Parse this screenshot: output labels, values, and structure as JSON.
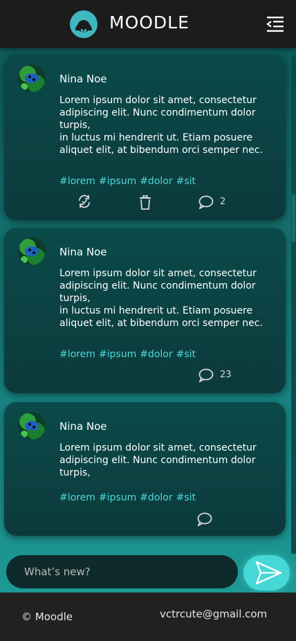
{
  "header": {
    "brand": "MOODLE",
    "logo_icon": "moodle-logo-icon",
    "menu_icon": "menu-collapse-icon"
  },
  "posts": [
    {
      "author": "Nina Noe",
      "text": "Lorem ipsum dolor sit amet, consectetur adipiscing elit. Nunc condimentum dolor turpis,\nin luctus mi hendrerit ut. Etiam posuere aliquet elit, at bibendum orci semper nec.",
      "tags": [
        "#lorem",
        "#ipsum",
        "#dolor",
        "#sit"
      ],
      "show_repost": true,
      "show_delete": true,
      "comments": "2"
    },
    {
      "author": "Nina Noe",
      "text": "Lorem ipsum dolor sit amet, consectetur adipiscing elit. Nunc condimentum dolor turpis,\nin luctus mi hendrerit ut. Etiam posuere aliquet elit, at bibendum orci semper nec.",
      "tags": [
        "#lorem",
        "#ipsum",
        "#dolor",
        "#sit"
      ],
      "show_repost": false,
      "show_delete": false,
      "comments": "23"
    },
    {
      "author": "Nina Noe",
      "text": "Lorem ipsum dolor sit amet, consectetur adipiscing elit. Nunc condimentum dolor turpis,",
      "tags": [
        "#lorem",
        "#ipsum",
        "#dolor",
        "#sit"
      ],
      "show_repost": false,
      "show_delete": false,
      "comments": ""
    }
  ],
  "composer": {
    "placeholder": "What’s  new?"
  },
  "footer": {
    "copyright": "© Moodle",
    "email": "vctrcute@gmail.com"
  },
  "colors": {
    "accent": "#45d8d6",
    "tag": "#4fd9d6",
    "header_bg": "#1c1c1c",
    "card_bg": "#0b4a4a"
  }
}
